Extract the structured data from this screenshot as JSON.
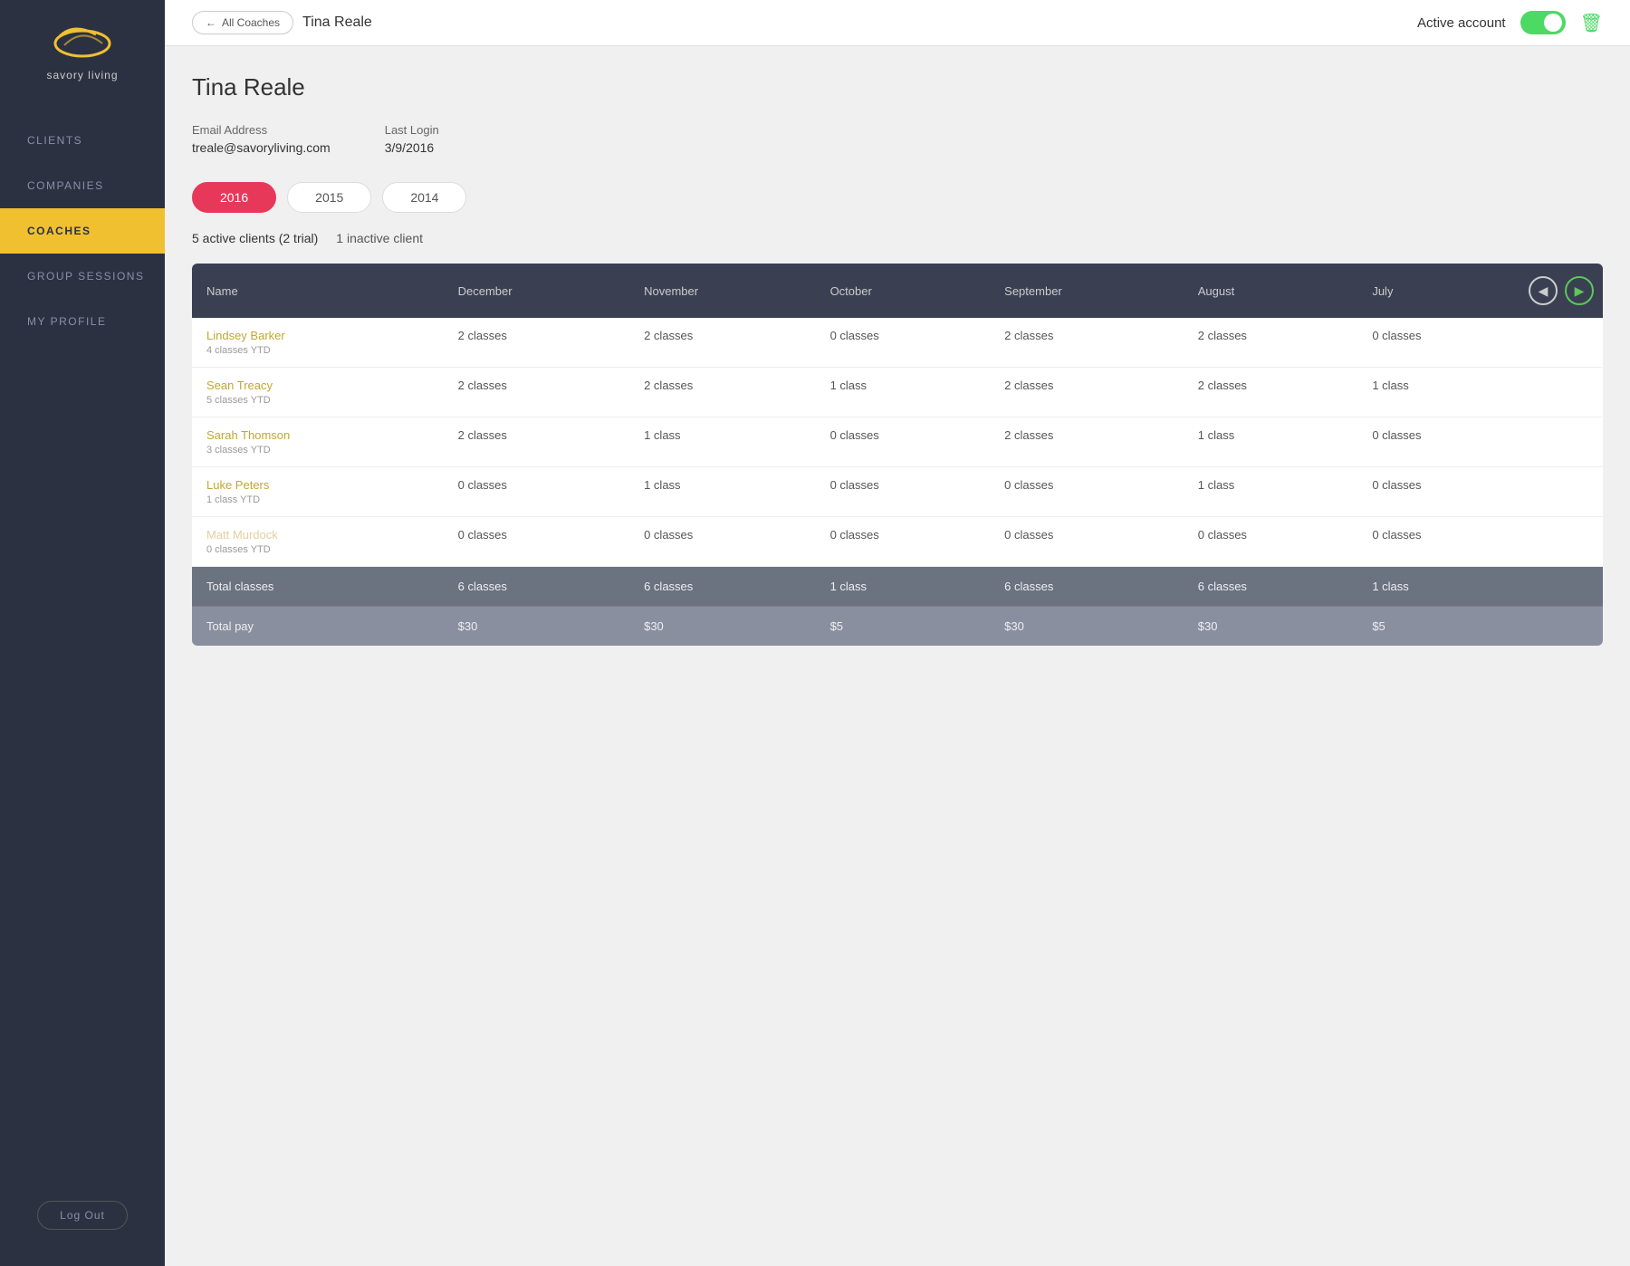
{
  "sidebar": {
    "logo_text": "savory living",
    "nav_items": [
      {
        "id": "clients",
        "label": "CLIENTS",
        "active": false
      },
      {
        "id": "companies",
        "label": "COMPANIES",
        "active": false
      },
      {
        "id": "coaches",
        "label": "COACHES",
        "active": true
      },
      {
        "id": "group-sessions",
        "label": "GROUP SESSIONS",
        "active": false
      },
      {
        "id": "my-profile",
        "label": "MY PROFILE",
        "active": false
      }
    ],
    "logout_label": "Log Out"
  },
  "topbar": {
    "back_label": "All Coaches",
    "breadcrumb_name": "Tina Reale",
    "active_account_label": "Active account",
    "toggle_on": true
  },
  "page": {
    "title": "Tina Reale",
    "email_label": "Email Address",
    "email_value": "treale@savoryliving.com",
    "last_login_label": "Last Login",
    "last_login_value": "3/9/2016",
    "year_tabs": [
      {
        "label": "2016",
        "active": true
      },
      {
        "label": "2015",
        "active": false
      },
      {
        "label": "2014",
        "active": false
      }
    ],
    "summary_active": "5 active clients (2 trial)",
    "summary_inactive": "1 inactive client"
  },
  "table": {
    "columns": [
      "Name",
      "December",
      "November",
      "October",
      "September",
      "August",
      "July"
    ],
    "rows": [
      {
        "name": "Lindsey Barker",
        "ytd": "4 classes YTD",
        "inactive": false,
        "cells": [
          "2 classes",
          "2 classes",
          "0 classes",
          "2 classes",
          "2 classes",
          "0 classes"
        ]
      },
      {
        "name": "Sean Treacy",
        "ytd": "5 classes YTD",
        "inactive": false,
        "cells": [
          "2 classes",
          "2 classes",
          "1 class",
          "2 classes",
          "2 classes",
          "1 class"
        ]
      },
      {
        "name": "Sarah Thomson",
        "ytd": "3 classes YTD",
        "inactive": false,
        "cells": [
          "2 classes",
          "1 class",
          "0 classes",
          "2 classes",
          "1 class",
          "0 classes"
        ]
      },
      {
        "name": "Luke Peters",
        "ytd": "1 class YTD",
        "inactive": false,
        "cells": [
          "0 classes",
          "1 class",
          "0 classes",
          "0 classes",
          "1 class",
          "0 classes"
        ]
      },
      {
        "name": "Matt Murdock",
        "ytd": "0 classes YTD",
        "inactive": true,
        "cells": [
          "0 classes",
          "0 classes",
          "0 classes",
          "0 classes",
          "0 classes",
          "0 classes"
        ]
      }
    ],
    "total_classes_label": "Total classes",
    "total_classes": [
      "6 classes",
      "6 classes",
      "1 class",
      "6 classes",
      "6 classes",
      "1 class"
    ],
    "total_pay_label": "Total pay",
    "total_pay": [
      "$30",
      "$30",
      "$5",
      "$30",
      "$30",
      "$5"
    ]
  }
}
